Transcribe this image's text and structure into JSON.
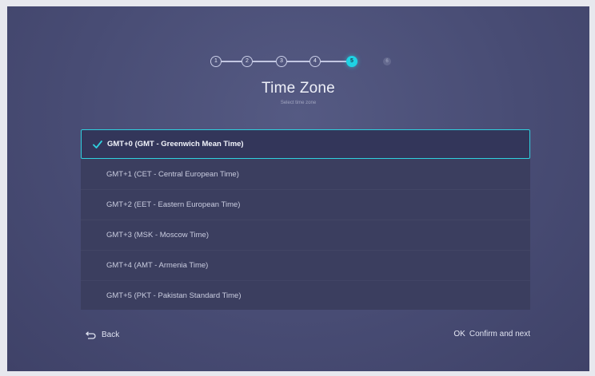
{
  "stepper": {
    "steps": [
      "1",
      "2",
      "3",
      "4",
      "5",
      "6"
    ],
    "active_step": 5
  },
  "header": {
    "title": "Time Zone",
    "subtitle": "Select time zone"
  },
  "timezones": {
    "items": [
      {
        "label": "GMT+0 (GMT - Greenwich Mean Time)",
        "selected": true
      },
      {
        "label": "GMT+1 (CET - Central European Time)",
        "selected": false
      },
      {
        "label": "GMT+2 (EET - Eastern European Time)",
        "selected": false
      },
      {
        "label": "GMT+3 (MSK - Moscow Time)",
        "selected": false
      },
      {
        "label": "GMT+4 (AMT - Armenia Time)",
        "selected": false
      },
      {
        "label": "GMT+5 (PKT - Pakistan Standard Time)",
        "selected": false
      }
    ]
  },
  "footer": {
    "back_label": "Back",
    "ok_icon_label": "OK",
    "confirm_label": "Confirm and next"
  },
  "colors": {
    "accent": "#1fd2e4",
    "background": "#484c74",
    "list_background": "#3b3e5f"
  }
}
